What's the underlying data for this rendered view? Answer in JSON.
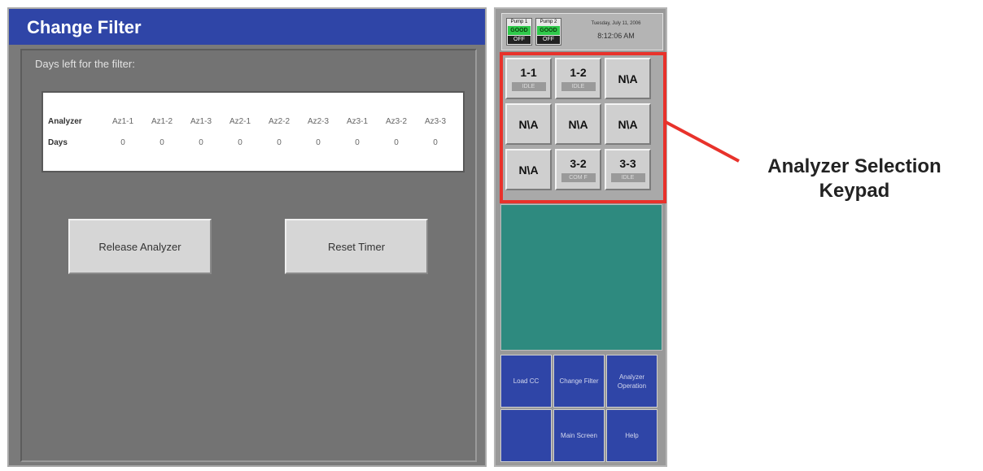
{
  "window": {
    "title": "Change Filter"
  },
  "filter": {
    "label": "Days left for the filter:",
    "row_headers": [
      "Analyzer",
      "Days"
    ],
    "analyzers": [
      "Az1-1",
      "Az1-2",
      "Az1-3",
      "Az2-1",
      "Az2-2",
      "Az2-3",
      "Az3-1",
      "Az3-2",
      "Az3-3"
    ],
    "days": [
      "0",
      "0",
      "0",
      "0",
      "0",
      "0",
      "0",
      "0",
      "0"
    ]
  },
  "buttons": {
    "release": "Release Analyzer",
    "reset": "Reset Timer"
  },
  "status": {
    "pumps": [
      {
        "label": "Pump 1",
        "state": "GOOD",
        "power": "OFF"
      },
      {
        "label": "Pump 2",
        "state": "GOOD",
        "power": "OFF"
      }
    ],
    "date": "Tuesday, July 11, 2006",
    "time": "8:12:06 AM"
  },
  "keypad": {
    "keys": [
      {
        "label": "1-1",
        "status": "IDLE"
      },
      {
        "label": "1-2",
        "status": "IDLE"
      },
      {
        "label": "N\\A",
        "status": ""
      },
      {
        "label": "N\\A",
        "status": ""
      },
      {
        "label": "N\\A",
        "status": ""
      },
      {
        "label": "N\\A",
        "status": ""
      },
      {
        "label": "N\\A",
        "status": ""
      },
      {
        "label": "3-2",
        "status": "COM F"
      },
      {
        "label": "3-3",
        "status": "IDLE"
      }
    ]
  },
  "nav": {
    "load_cc": "Load CC",
    "change_filter": "Change Filter",
    "analyzer_operation": "Analyzer Operation",
    "blank": "",
    "main_screen": "Main Screen",
    "help": "Help"
  },
  "callout": {
    "line1": "Analyzer Selection",
    "line2": "Keypad"
  },
  "colors": {
    "title_blue": "#2f45a7",
    "good_green": "#2fc94b",
    "teal": "#2e8a7f",
    "callout_red": "#e8322b"
  }
}
